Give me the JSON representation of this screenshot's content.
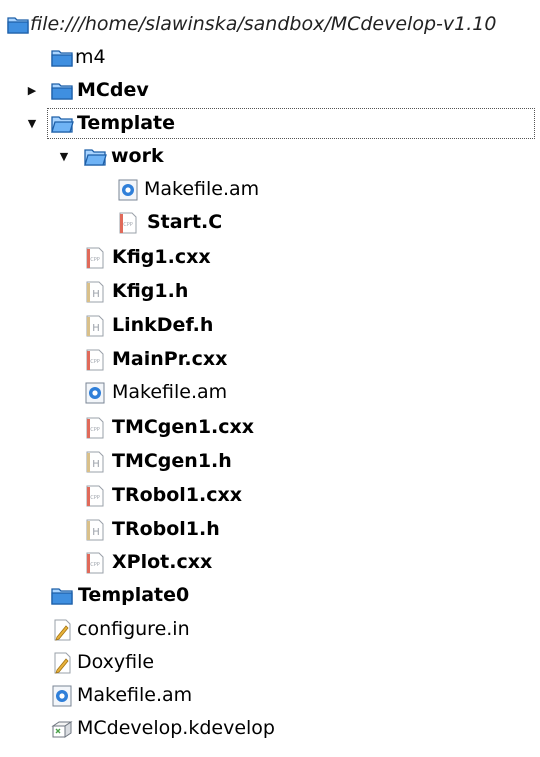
{
  "tree": {
    "rows": [
      {
        "label": "file:///home/slawinska/sandbox/MCdevelop-v1.10",
        "icon": "folder-icon",
        "style": "italic"
      },
      {
        "label": "m4",
        "icon": "folder-icon",
        "style": "normal"
      },
      {
        "label": "MCdev",
        "icon": "folder-icon",
        "style": "bold",
        "expander": "collapsed"
      },
      {
        "label": "Template",
        "icon": "folder-open-icon",
        "style": "bold",
        "expander": "expanded",
        "selected": true
      },
      {
        "label": "work",
        "icon": "folder-open-icon",
        "style": "bold",
        "expander": "expanded"
      },
      {
        "label": "Makefile.am",
        "icon": "makefile-icon",
        "style": "normal"
      },
      {
        "label": "Start.C",
        "icon": "cpp-source-icon",
        "style": "bold"
      },
      {
        "label": "Kfig1.cxx",
        "icon": "cpp-source-icon",
        "style": "bold"
      },
      {
        "label": "Kfig1.h",
        "icon": "header-file-icon",
        "style": "bold"
      },
      {
        "label": "LinkDef.h",
        "icon": "header-file-icon",
        "style": "bold"
      },
      {
        "label": "MainPr.cxx",
        "icon": "cpp-source-icon",
        "style": "bold"
      },
      {
        "label": "Makefile.am",
        "icon": "makefile-icon",
        "style": "normal"
      },
      {
        "label": "TMCgen1.cxx",
        "icon": "cpp-source-icon",
        "style": "bold"
      },
      {
        "label": "TMCgen1.h",
        "icon": "header-file-icon",
        "style": "bold"
      },
      {
        "label": "TRobol1.cxx",
        "icon": "cpp-source-icon",
        "style": "bold"
      },
      {
        "label": "TRobol1.h",
        "icon": "header-file-icon",
        "style": "bold"
      },
      {
        "label": "XPlot.cxx",
        "icon": "cpp-source-icon",
        "style": "bold"
      },
      {
        "label": "Template0",
        "icon": "folder-icon",
        "style": "bold"
      },
      {
        "label": "configure.in",
        "icon": "text-file-icon",
        "style": "normal"
      },
      {
        "label": "Doxyfile",
        "icon": "text-file-icon",
        "style": "normal"
      },
      {
        "label": "Makefile.am",
        "icon": "makefile-icon",
        "style": "normal"
      },
      {
        "label": "MCdevelop.kdevelop",
        "icon": "project-file-icon",
        "style": "normal"
      }
    ]
  },
  "colors": {
    "folder": "#3f8fe0",
    "folder_light": "#a9d4ff",
    "selection_outline": "#555555"
  }
}
